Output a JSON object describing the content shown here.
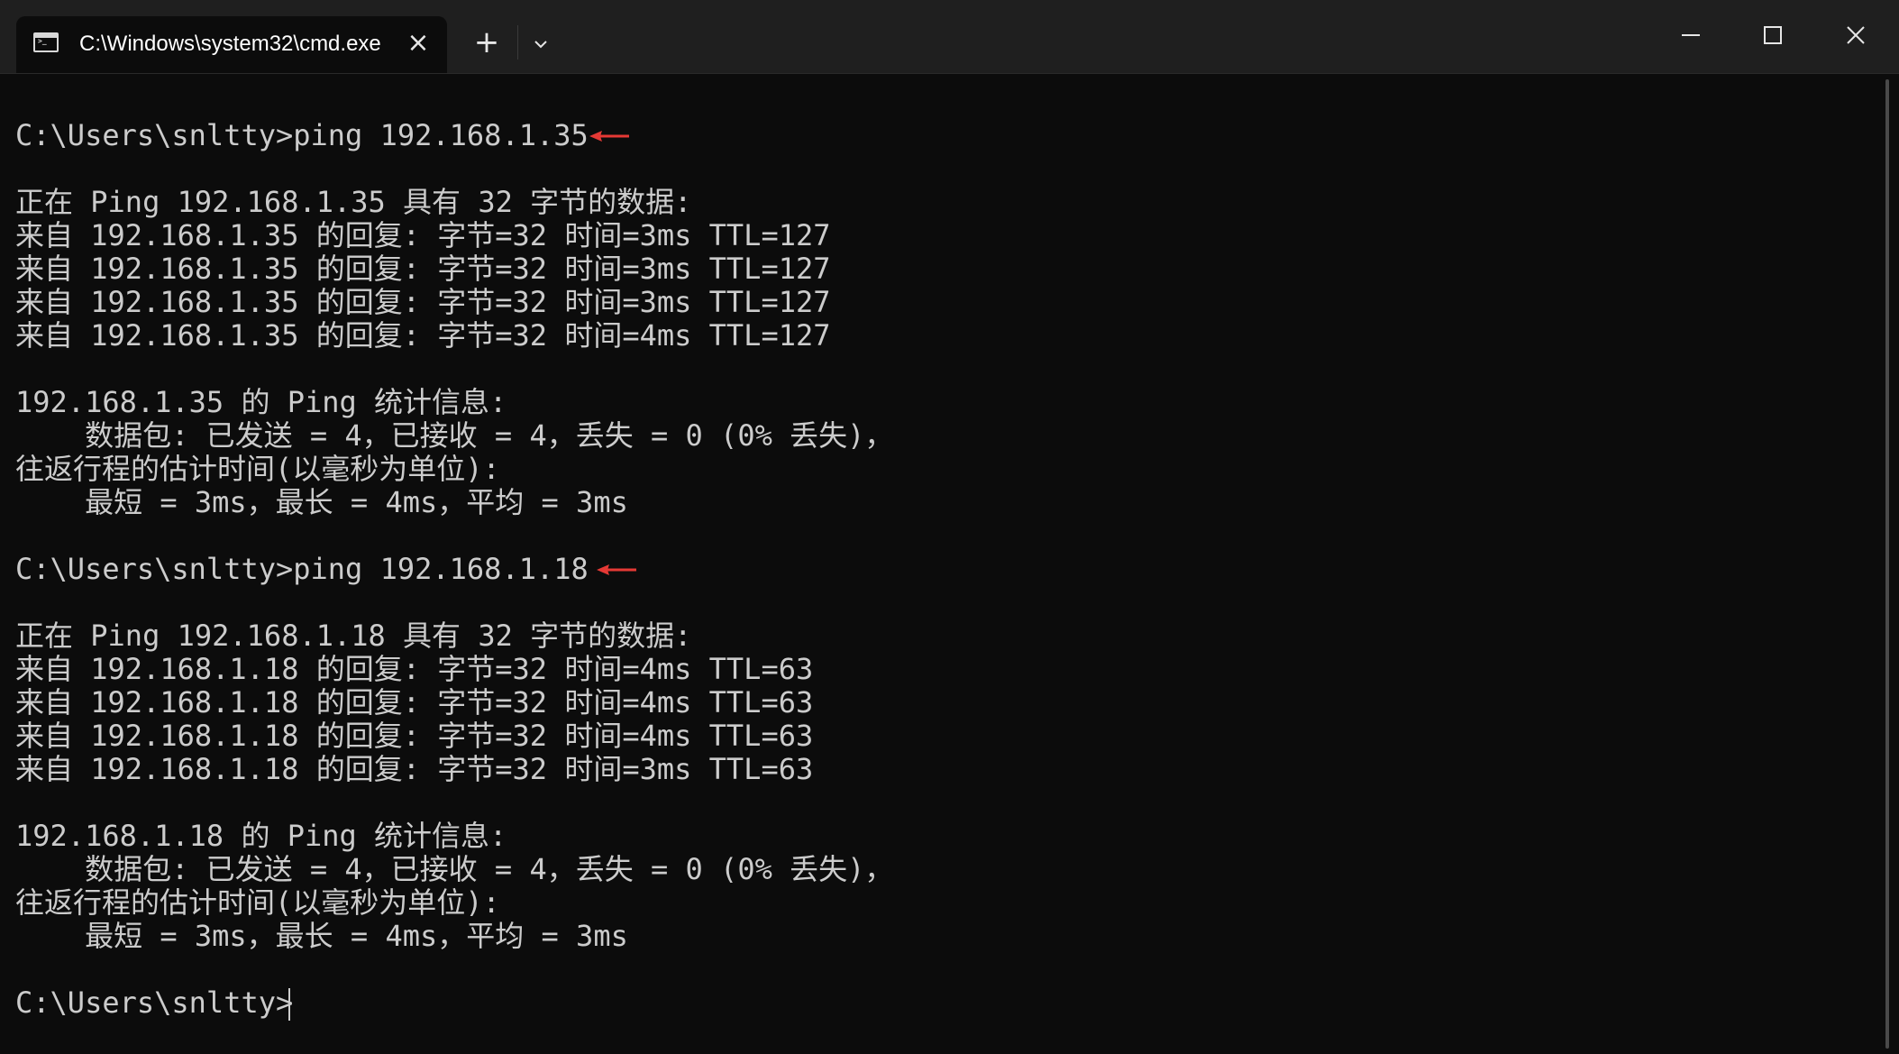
{
  "tab": {
    "title": "C:\\Windows\\system32\\cmd.exe",
    "icon": "cmd-terminal-icon",
    "close_icon": "close-icon"
  },
  "titlebar_controls": {
    "new_tab_icon": "plus-icon",
    "dropdown_icon": "chevron-down-icon",
    "minimize_icon": "minimize-icon",
    "maximize_icon": "maximize-icon",
    "close_icon": "close-icon"
  },
  "terminal": {
    "lines": [
      "C:\\Users\\snltty>ping 192.168.1.35",
      "正在 Ping 192.168.1.35 具有 32 字节的数据:",
      "来自 192.168.1.35 的回复: 字节=32 时间=3ms TTL=127",
      "来自 192.168.1.35 的回复: 字节=32 时间=3ms TTL=127",
      "来自 192.168.1.35 的回复: 字节=32 时间=3ms TTL=127",
      "来自 192.168.1.35 的回复: 字节=32 时间=4ms TTL=127",
      "192.168.1.35 的 Ping 统计信息:",
      "    数据包: 已发送 = 4，已接收 = 4，丢失 = 0 (0% 丢失)，",
      "往返行程的估计时间(以毫秒为单位):",
      "    最短 = 3ms，最长 = 4ms，平均 = 3ms",
      "C:\\Users\\snltty>ping 192.168.1.18",
      "正在 Ping 192.168.1.18 具有 32 字节的数据:",
      "来自 192.168.1.18 的回复: 字节=32 时间=4ms TTL=63",
      "来自 192.168.1.18 的回复: 字节=32 时间=4ms TTL=63",
      "来自 192.168.1.18 的回复: 字节=32 时间=4ms TTL=63",
      "来自 192.168.1.18 的回复: 字节=32 时间=3ms TTL=63",
      "192.168.1.18 的 Ping 统计信息:",
      "    数据包: 已发送 = 4，已接收 = 4，丢失 = 0 (0% 丢失)，",
      "往返行程的估计时间(以毫秒为单位):",
      "    最短 = 3ms，最长 = 4ms，平均 = 3ms",
      "C:\\Users\\snltty>"
    ]
  },
  "annotations": {
    "arrow_color": "#e53935"
  },
  "colors": {
    "background": "#0c0c0c",
    "text": "#cccccc",
    "titlebar": "#1f1f1f"
  }
}
